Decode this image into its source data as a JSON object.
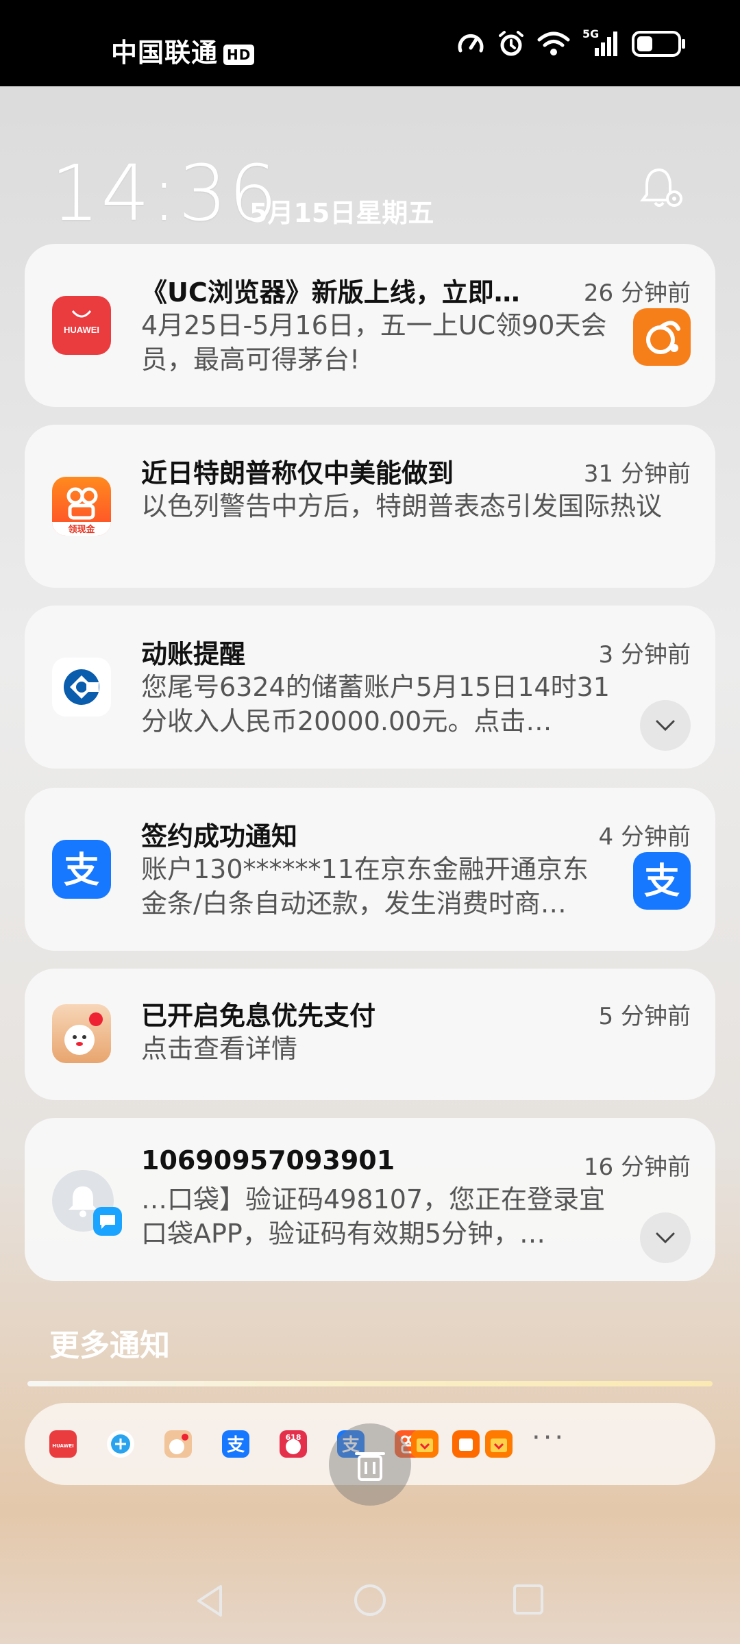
{
  "status_bar": {
    "carrier": "中国联通",
    "hd_badge": "HD",
    "icons": [
      "speed-icon",
      "alarm-icon",
      "wifi-icon",
      "signal-5g-icon",
      "battery-icon"
    ],
    "network": "5G"
  },
  "header": {
    "time": "14:36",
    "date": "5月15日星期五"
  },
  "notifications": [
    {
      "app_icon": "huawei-icon",
      "title": "《UC浏览器》新版上线，立即…",
      "time": "26 分钟前",
      "body": "4月25日-5月16日，五一上UC领90天会员，最高可得茅台!",
      "thumbnail": "uc-browser-icon"
    },
    {
      "app_icon": "kuaishou-icon",
      "app_icon_label": "领现金",
      "title": "近日特朗普称仅中美能做到",
      "time": "31 分钟前",
      "body": "以色列警告中方后，特朗普表态引发国际热议"
    },
    {
      "app_icon": "ccb-bank-icon",
      "title": "动账提醒",
      "time": "3 分钟前",
      "body": "您尾号6324的储蓄账户5月15日14时31分收入人民币20000.00元。点击…",
      "expandable": true
    },
    {
      "app_icon": "alipay-icon",
      "title": "签约成功通知",
      "time": "4 分钟前",
      "body": "账户130******11在京东金融开通京东金条/白条自动还款，发生消费时商…",
      "thumbnail": "alipay-icon"
    },
    {
      "app_icon": "jd-finance-icon",
      "title": "已开启免息优先支付",
      "time": "5 分钟前",
      "body": "点击查看详情"
    },
    {
      "app_icon": "messages-bell-icon",
      "title": "10690957093901",
      "time": "16 分钟前",
      "body": "…口袋】验证码498107，您正在登录宜口袋APP，验证码有效期5分钟，…",
      "expandable": true
    }
  ],
  "more_notifications": {
    "label": "更多通知",
    "tray_icons": [
      "huawei-icon",
      "browser-icon",
      "jd-icon",
      "alipay-icon",
      "jd-618-icon",
      "alipay-icon",
      "kuaishou-icon",
      "taobao-icon",
      "gift-icon",
      "gift-icon"
    ],
    "more_glyph": "···"
  },
  "colors": {
    "huawei_red": "#ea3b3f",
    "uc_orange": "#f77f1a",
    "alipay_blue": "#1677ff",
    "ccb_blue": "#0a5cad"
  }
}
